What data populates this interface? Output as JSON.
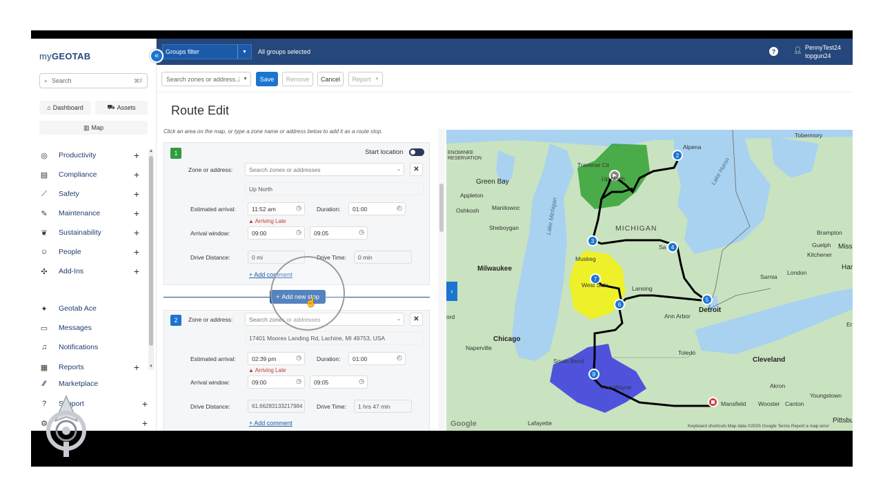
{
  "sidebar": {
    "logo_prefix": "my",
    "logo_brand": "GEOTAB",
    "search_placeholder": "Search",
    "search_shortcut": "⌘F",
    "dashboard_label": "Dashboard",
    "assets_label": "Assets",
    "map_label": "Map",
    "items": [
      {
        "label": "Productivity"
      },
      {
        "label": "Compliance"
      },
      {
        "label": "Safety"
      },
      {
        "label": "Maintenance"
      },
      {
        "label": "Sustainability"
      },
      {
        "label": "People"
      },
      {
        "label": "Add-Ins"
      },
      {
        "label": "Geotab Ace"
      },
      {
        "label": "Messages"
      },
      {
        "label": "Notifications"
      },
      {
        "label": "Reports"
      },
      {
        "label": "Marketplace"
      },
      {
        "label": "Support"
      }
    ]
  },
  "topbar": {
    "groups_filter": "Groups filter",
    "all_groups": "All groups selected",
    "user_name": "PennyTest24",
    "user_db": "topgun24"
  },
  "toolbar": {
    "zone_search_placeholder": "Search zones or address...",
    "save": "Save",
    "remove": "Remove",
    "cancel": "Cancel",
    "report": "Report"
  },
  "page_title": "Route Edit",
  "form": {
    "hint": "Click an area on the map, or type a zone name or address below to add it as a route stop.",
    "start_location_label": "Start location",
    "add_new_stop": "Add new stop",
    "stops": [
      {
        "number": "1",
        "zone_label": "Zone or address:",
        "zone_placeholder": "Search zones or addresses",
        "zone_value": "Up North",
        "est_arrival_label": "Estimated arrival:",
        "est_arrival": "11:52 am",
        "duration_label": "Duration:",
        "duration": "01:00",
        "status": "Arriving Late",
        "arrival_window_label": "Arrival window:",
        "window_start": "09:00",
        "window_end": "09:05",
        "drive_distance_label": "Drive Distance:",
        "drive_distance": "0 mi",
        "drive_time_label": "Drive Time:",
        "drive_time": "0 min",
        "add_comment": "Add comment"
      },
      {
        "number": "2",
        "zone_label": "Zone or address:",
        "zone_placeholder": "Search zones or addresses",
        "zone_value": "17401 Moores Landing Rd, Lachine, MI 49753, USA",
        "est_arrival_label": "Estimated arrival:",
        "est_arrival": "02:39 pm",
        "duration_label": "Duration:",
        "duration": "01:00",
        "status": "Arriving Late",
        "arrival_window_label": "Arrival window:",
        "window_start": "09:00",
        "window_end": "09:05",
        "drive_distance_label": "Drive Distance:",
        "drive_distance": "61.66283133217984",
        "drive_time_label": "Drive Time:",
        "drive_time": "1 hrs  47 min",
        "add_comment": "Add comment"
      }
    ]
  },
  "map": {
    "labels": {
      "green_bay": "Green Bay",
      "milwaukee": "Milwaukee",
      "chicago": "Chicago",
      "michigan": "MICHIGAN",
      "detroit": "Detroit",
      "ann_arbor": "Ann Arbor",
      "lansing": "Lansing",
      "toledo": "Toledo",
      "cleveland": "Cleveland",
      "london": "London",
      "kitchener": "Kitchener",
      "brampton": "Brampton",
      "guelph": "Guelph",
      "hamilton": "Hami",
      "sarnia": "Sarnia",
      "akron": "Akron",
      "canton": "Canton",
      "youngstown": "Youngstown",
      "mansfield": "Mansfield",
      "wooster": "Wooster",
      "south_bend": "South Bend",
      "fort_wayne": "Fort Wayne",
      "naperville": "Naperville",
      "lafayette": "Lafayette",
      "pittsburgh": "Pittsbur",
      "traverse_city": "Traverse Cit",
      "alpena": "Alpena",
      "manitowoc": "Manitowoc",
      "sheboygan": "Sheboygan",
      "oshkosh": "Oshkosh",
      "appleton": "Appleton",
      "muskegon": "Muskeg",
      "tobermory": "Tobermory",
      "erie": "Erie",
      "reservation": "RESERVATION",
      "lake_michigan": "Lake Michigan",
      "lake_huron": "Lake Huron",
      "ford": "ord",
      "west_side": "West Side",
      "up_north": "Up North",
      "saginaw": "Sa",
      "miss": "Miss",
      "menominee": "ENOMINEE"
    },
    "stops": [
      "1",
      "2",
      "3",
      "4",
      "5",
      "6",
      "7",
      "8"
    ],
    "footer": "Keyboard shortcuts   Map data ©2025 Google   Terms   Report a map error",
    "google": "Google",
    "colors": {
      "zone_green": "#2a9d2a",
      "zone_yellow": "#f2f21a",
      "zone_blue": "#3a3ae0",
      "stop_blue": "#1b74d0",
      "route": "#000000",
      "water": "#a9d2f0",
      "land": "#c9e3c0"
    }
  }
}
